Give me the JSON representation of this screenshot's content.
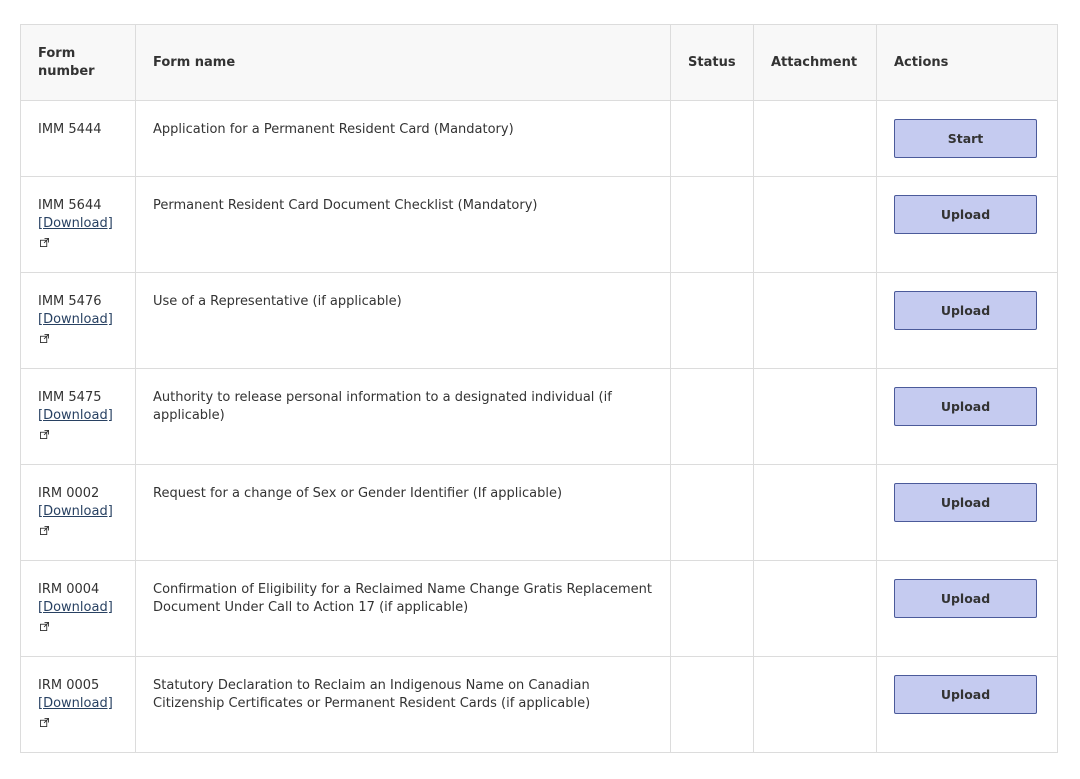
{
  "table": {
    "headers": {
      "form_number": "Form number",
      "form_name": "Form name",
      "status": "Status",
      "attachment": "Attachment",
      "actions": "Actions"
    },
    "download_label": "[Download]",
    "rows": [
      {
        "code": "IMM 5444",
        "name": "Application for a Permanent Resident Card (Mandatory)",
        "status": "",
        "attachment": "",
        "action": "Start",
        "has_download": false
      },
      {
        "code": "IMM 5644",
        "name": "Permanent Resident Card Document Checklist (Mandatory)",
        "status": "",
        "attachment": "",
        "action": "Upload",
        "has_download": true
      },
      {
        "code": "IMM 5476",
        "name": "Use of a Representative (if applicable)",
        "status": "",
        "attachment": "",
        "action": "Upload",
        "has_download": true
      },
      {
        "code": "IMM 5475",
        "name": "Authority to release personal information to a designated individual (if applicable)",
        "status": "",
        "attachment": "",
        "action": "Upload",
        "has_download": true
      },
      {
        "code": "IRM 0002",
        "name": "Request for a change of Sex or Gender Identifier (If applicable)",
        "status": "",
        "attachment": "",
        "action": "Upload",
        "has_download": true
      },
      {
        "code": "IRM 0004",
        "name": "Confirmation of Eligibility for a Reclaimed Name Change Gratis Replacement Document Under Call to Action 17 (if applicable)",
        "status": "",
        "attachment": "",
        "action": "Upload",
        "has_download": true
      },
      {
        "code": "IRM 0005",
        "name": "Statutory Declaration to Reclaim an Indigenous Name on Canadian Citizenship Certificates or Permanent Resident Cards (if applicable)",
        "status": "",
        "attachment": "",
        "action": "Upload",
        "has_download": true
      }
    ]
  },
  "icons": {
    "external_link": "external-link-icon"
  },
  "colors": {
    "button_bg": "#c5cbf0",
    "button_border": "#4b5a9a",
    "link": "#284162",
    "header_bg": "#f8f8f8",
    "border": "#dcdcdc"
  }
}
